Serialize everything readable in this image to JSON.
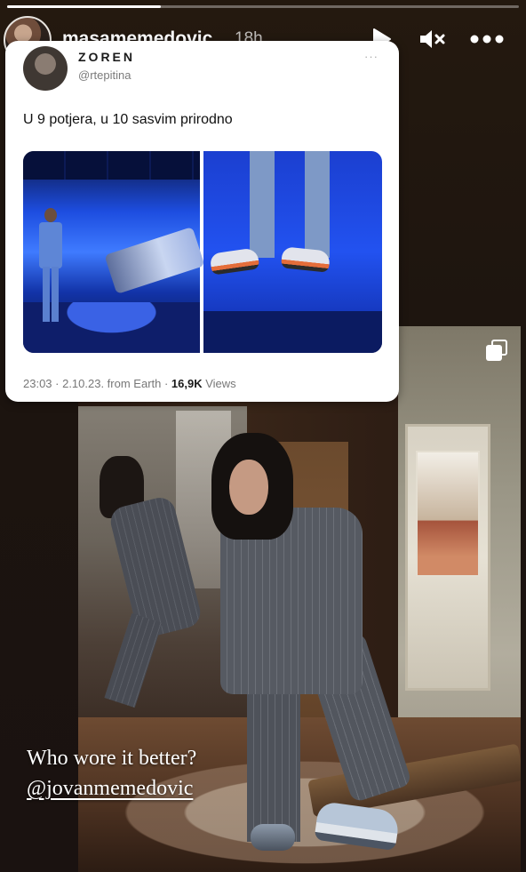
{
  "story": {
    "username": "masamemedovic",
    "timestamp": "18h",
    "progress": 0.3,
    "controls": {
      "play_icon": "play-icon",
      "mute_icon": "speaker-muted-icon",
      "more_icon": "more-horizontal-icon"
    }
  },
  "tweet": {
    "name": "ZOREN",
    "handle": "@rtepitina",
    "text": "U 9 potjera, u 10 sasvim prirodno",
    "meta_time": "23:03 · 2.10.23. from Earth · ",
    "views_count": "16,9K",
    "views_label": " Views"
  },
  "caption": {
    "line1": "Who wore it better?",
    "mention": "@jovanmemedovic"
  },
  "colors": {
    "tweet_bg": "#ffffff",
    "stage_blue": "#1d4de0",
    "story_bg": "#1c140f"
  }
}
